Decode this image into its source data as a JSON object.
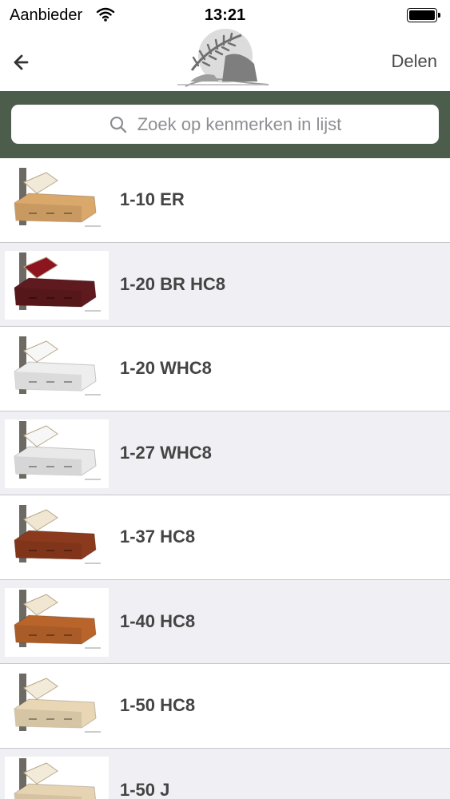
{
  "status_bar": {
    "carrier": "Aanbieder",
    "time": "13:21"
  },
  "nav": {
    "share_label": "Delen"
  },
  "search": {
    "placeholder": "Zoek op kenmerken in lijst"
  },
  "items": [
    {
      "title": "1-10 ER",
      "wood": "#d9a86a",
      "lining": "#f2ead8"
    },
    {
      "title": "1-20 BR HC8",
      "wood": "#5e1a1e",
      "lining": "#8c1520"
    },
    {
      "title": "1-20 WHC8",
      "wood": "#eeeeee",
      "lining": "#f7f7f7"
    },
    {
      "title": "1-27 WHC8",
      "wood": "#e9e9ea",
      "lining": "#f7f7f7"
    },
    {
      "title": "1-37 HC8",
      "wood": "#8b3a1d",
      "lining": "#f0e6d2"
    },
    {
      "title": "1-40 HC8",
      "wood": "#b8642b",
      "lining": "#f0e6d2"
    },
    {
      "title": "1-50 HC8",
      "wood": "#e8d6b4",
      "lining": "#f3ebd9"
    },
    {
      "title": "1-50 J",
      "wood": "#e6d3b1",
      "lining": "#f3ebd9"
    }
  ]
}
